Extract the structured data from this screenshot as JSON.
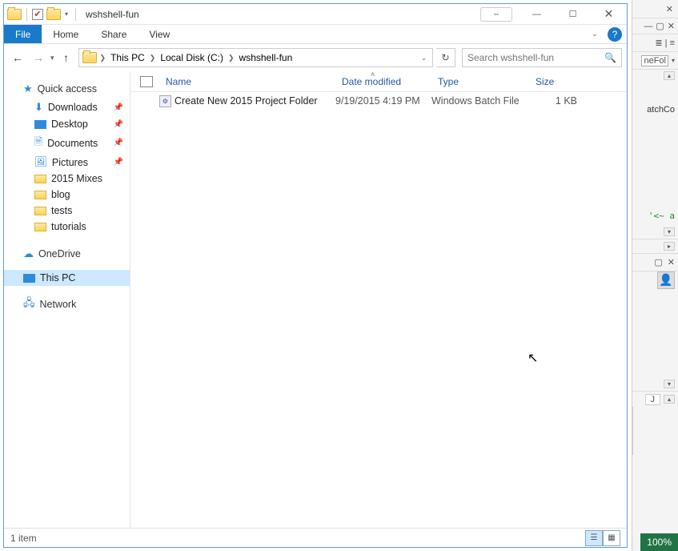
{
  "titlebar": {
    "title": "wshshell-fun"
  },
  "tabs": {
    "file": "File",
    "home": "Home",
    "share": "Share",
    "view": "View"
  },
  "breadcrumb": {
    "root": "This PC",
    "drive": "Local Disk (C:)",
    "folder": "wshshell-fun"
  },
  "search": {
    "placeholder": "Search wshshell-fun"
  },
  "sidebar": {
    "quick_access": "Quick access",
    "items_pinned": [
      {
        "label": "Downloads"
      },
      {
        "label": "Desktop"
      },
      {
        "label": "Documents"
      },
      {
        "label": "Pictures"
      }
    ],
    "items_recent": [
      {
        "label": "2015 Mixes"
      },
      {
        "label": "blog"
      },
      {
        "label": "tests"
      },
      {
        "label": "tutorials"
      }
    ],
    "onedrive": "OneDrive",
    "thispc": "This PC",
    "network": "Network"
  },
  "columns": {
    "name": "Name",
    "date": "Date modified",
    "type": "Type",
    "size": "Size"
  },
  "files": [
    {
      "name": "Create New 2015 Project Folder",
      "date": "9/19/2015 4:19 PM",
      "type": "Windows Batch File",
      "size": "1 KB"
    }
  ],
  "statusbar": {
    "count": "1 item"
  },
  "background": {
    "dropdown_text": "neFol",
    "text_frag_1": "atchCo",
    "text_frag_2": "'<~ a",
    "cell_j": "J",
    "zoom": "100%"
  }
}
